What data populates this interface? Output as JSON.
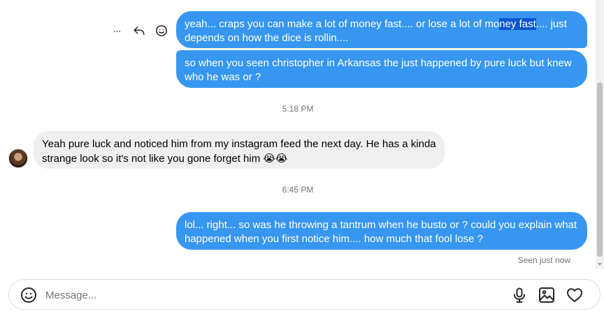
{
  "messages": [
    {
      "direction": "outgoing",
      "text_before": "yeah... craps you can make a lot of money fast.... or lose a lot of mo",
      "text_highlight": "ney fast",
      "text_after": ".... just depends on how the dice is rollin...."
    },
    {
      "direction": "outgoing",
      "text": "so when you seen christopher in Arkansas the just happened by pure luck but knew who he was or ?"
    },
    {
      "direction": "incoming",
      "text": "Yeah pure luck and noticed him from my instagram feed the next day. He has a kinda strange look so it's not like you gone forget him",
      "emoji": "😭😭"
    },
    {
      "direction": "outgoing",
      "text": "lol... right... so was he throwing a tantrum when he busto or ?  could you explain what happened when you first notice him.... how much that fool lose ?"
    }
  ],
  "timestamps": [
    "5:18 PM",
    "6:45 PM"
  ],
  "seen_status": "Seen just now",
  "message_actions": {
    "more_icon": "more-horizontal-icon",
    "reply_icon": "reply-icon",
    "react_icon": "emoji-react-icon",
    "more_glyph": "···"
  },
  "composer": {
    "placeholder": "Message...",
    "value": "",
    "icons": [
      "emoji-icon",
      "microphone-icon",
      "image-icon",
      "heart-icon"
    ]
  },
  "colors": {
    "outgoing_bubble": "#3797f0",
    "incoming_bubble": "#efefef",
    "selection_highlight": "#0b57d0",
    "meta_text": "#737373"
  }
}
